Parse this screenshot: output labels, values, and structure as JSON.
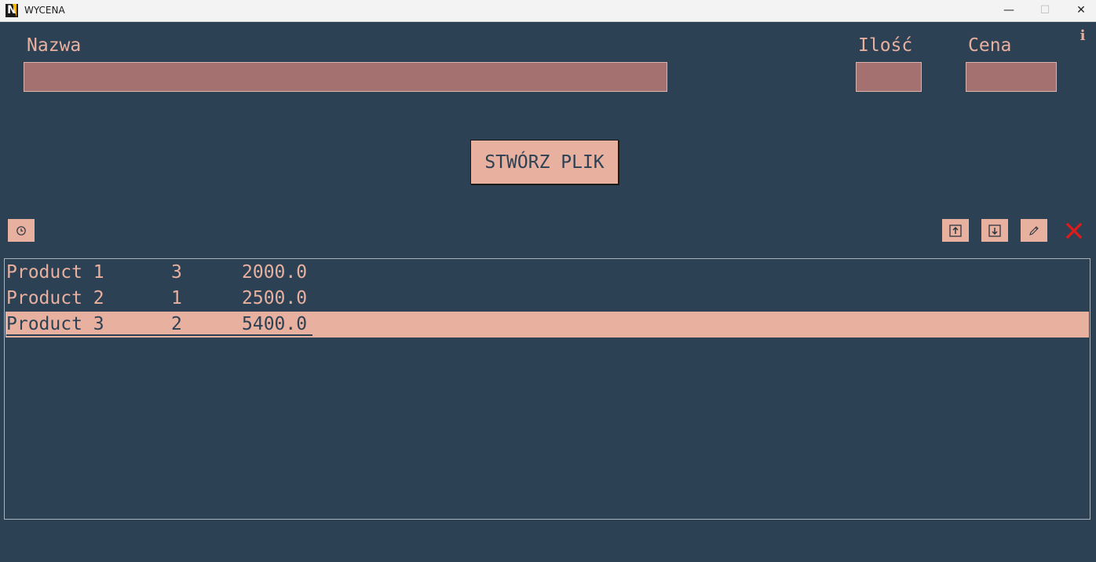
{
  "window": {
    "title": "WYCENA",
    "app_icon_letter": "N",
    "minimize_glyph": "—",
    "maximize_glyph": "☐",
    "close_glyph": "✕"
  },
  "form": {
    "name_label": "Nazwa",
    "name_value": "",
    "quantity_label": "Ilość",
    "quantity_value": "",
    "price_label": "Cena",
    "price_value": ""
  },
  "info_glyph": "i",
  "create_button_label": "STWÓRZ PLIK",
  "toolbar": {
    "history_icon": "clock-icon",
    "move_up_icon": "arrow-up-box-icon",
    "move_down_icon": "arrow-down-box-icon",
    "edit_icon": "pencil-icon",
    "delete_icon": "red-x-icon",
    "delete_color": "#e01b1b"
  },
  "colors": {
    "background": "#2d4155",
    "accent": "#e8b09e",
    "input_fill": "#a57070"
  },
  "items": [
    {
      "name": "Product 1",
      "quantity": "3",
      "price": "2000.0",
      "selected": false
    },
    {
      "name": "Product 2",
      "quantity": "1",
      "price": "2500.0",
      "selected": false
    },
    {
      "name": "Product 3",
      "quantity": "2",
      "price": "5400.0",
      "selected": true
    }
  ]
}
